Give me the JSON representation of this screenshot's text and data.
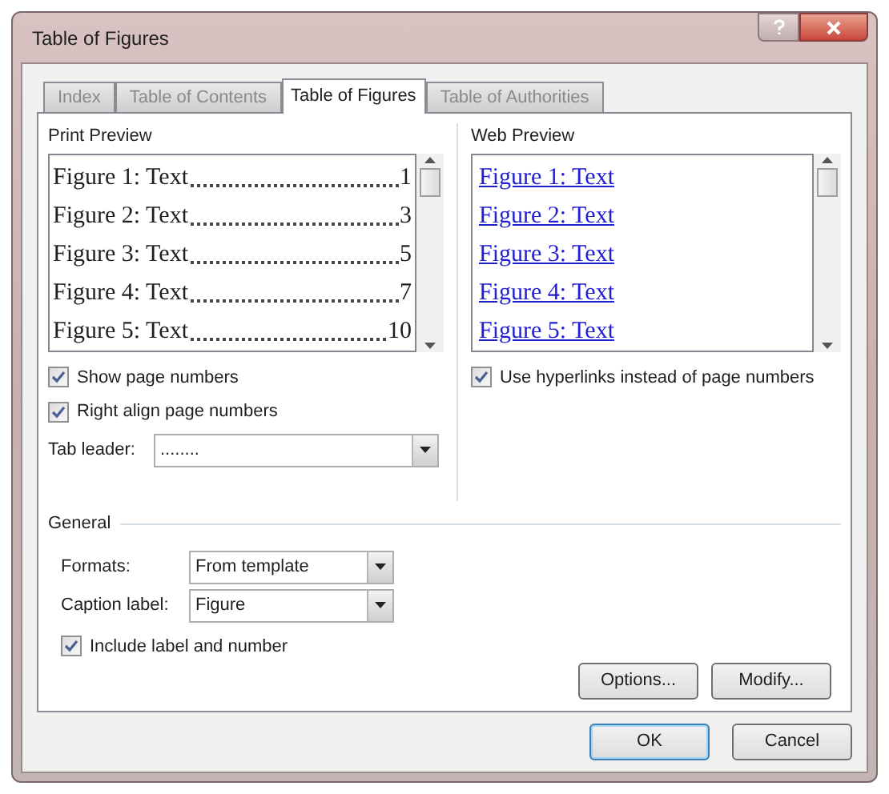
{
  "window": {
    "title": "Table of Figures"
  },
  "tabs": [
    {
      "label": "Index",
      "selected": false
    },
    {
      "label": "Table of Contents",
      "selected": false
    },
    {
      "label": "Table of Figures",
      "selected": true
    },
    {
      "label": "Table of Authorities",
      "selected": false
    }
  ],
  "print_preview": {
    "label": "Print Preview",
    "entries": [
      {
        "text": "Figure 1: Text",
        "page": "1"
      },
      {
        "text": "Figure 2: Text",
        "page": "3"
      },
      {
        "text": "Figure 3: Text",
        "page": "5"
      },
      {
        "text": "Figure 4: Text",
        "page": "7"
      },
      {
        "text": "Figure 5: Text",
        "page": "10"
      }
    ],
    "options": [
      {
        "label": "Show page numbers",
        "checked": true
      },
      {
        "label": "Right align page numbers",
        "checked": true
      }
    ],
    "tab_leader": {
      "label": "Tab leader:",
      "value": "........"
    }
  },
  "web_preview": {
    "label": "Web Preview",
    "entries": [
      "Figure 1: Text",
      "Figure 2: Text",
      "Figure 3: Text",
      "Figure 4: Text",
      "Figure 5: Text"
    ],
    "option": {
      "label": "Use hyperlinks instead of page numbers",
      "checked": true
    }
  },
  "general": {
    "label": "General",
    "fields": [
      {
        "label": "Formats:",
        "value": "From template"
      },
      {
        "label": "Caption label:",
        "value": "Figure"
      }
    ],
    "option": {
      "label": "Include label and number",
      "checked": true
    }
  },
  "panel_buttons": [
    "Options...",
    "Modify..."
  ],
  "dialog_buttons": [
    {
      "label": "OK",
      "kind": "default"
    },
    {
      "label": "Cancel",
      "kind": "normal"
    }
  ]
}
